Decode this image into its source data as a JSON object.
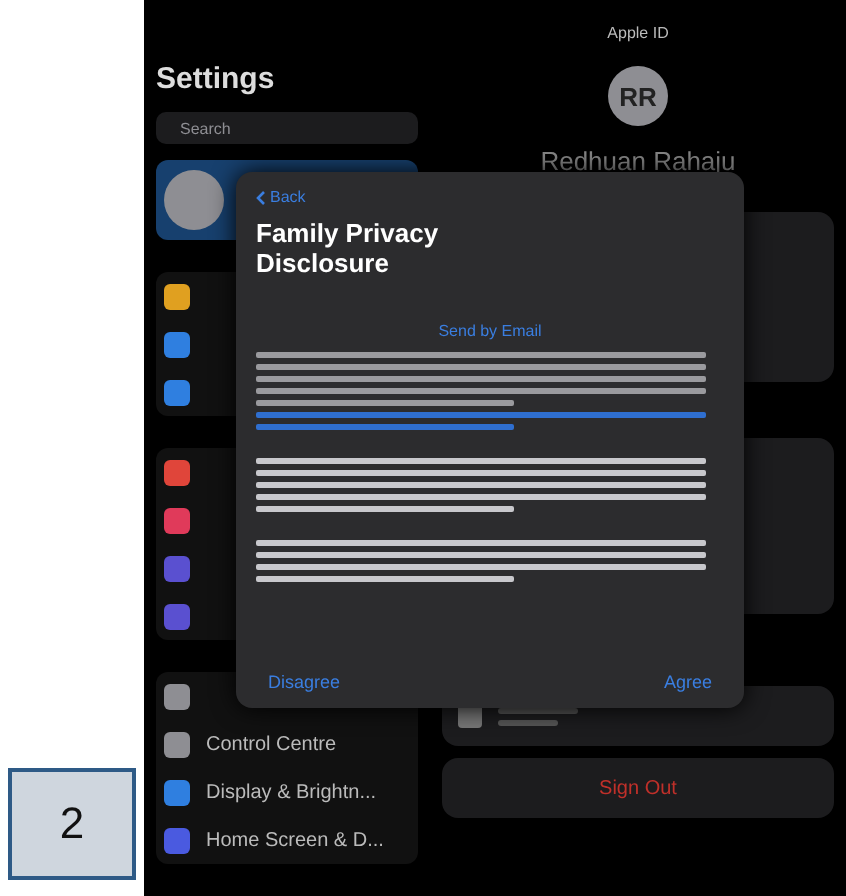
{
  "sidebar": {
    "title": "Settings",
    "search": {
      "placeholder": "Search"
    },
    "account": {
      "selected": true
    },
    "groups": [
      {
        "items": [
          {
            "color": "#e0a020",
            "selected": false
          },
          {
            "color": "#2f7fe0",
            "selected": false
          },
          {
            "color": "#2f7fe0",
            "selected": false
          }
        ]
      },
      {
        "items": [
          {
            "color": "#e0453a",
            "selected": false
          },
          {
            "color": "#e03a5a",
            "selected": false
          },
          {
            "color": "#5a50d0",
            "selected": false
          },
          {
            "color": "#5a50d0",
            "selected": false
          }
        ]
      },
      {
        "items": [
          {
            "color": "#8e8e93",
            "selected": false
          },
          {
            "label": "Control Centre",
            "color": "#8e8e93",
            "selected": false
          },
          {
            "label": "Display & Brightn...",
            "color": "#2f7fe0",
            "selected": false
          },
          {
            "label": "Home Screen & D...",
            "color": "#4a5ae0",
            "selected": false
          }
        ]
      }
    ]
  },
  "apple_id": {
    "header": "Apple ID",
    "initials": "RR",
    "name": "Redhuan Rahaju",
    "sign_out": "Sign Out"
  },
  "sheet": {
    "back": "Back",
    "title": "Family Privacy Disclosure",
    "send_link": "Send by Email",
    "buttons": [
      "Disagree",
      "Agree"
    ]
  },
  "badge": "2"
}
